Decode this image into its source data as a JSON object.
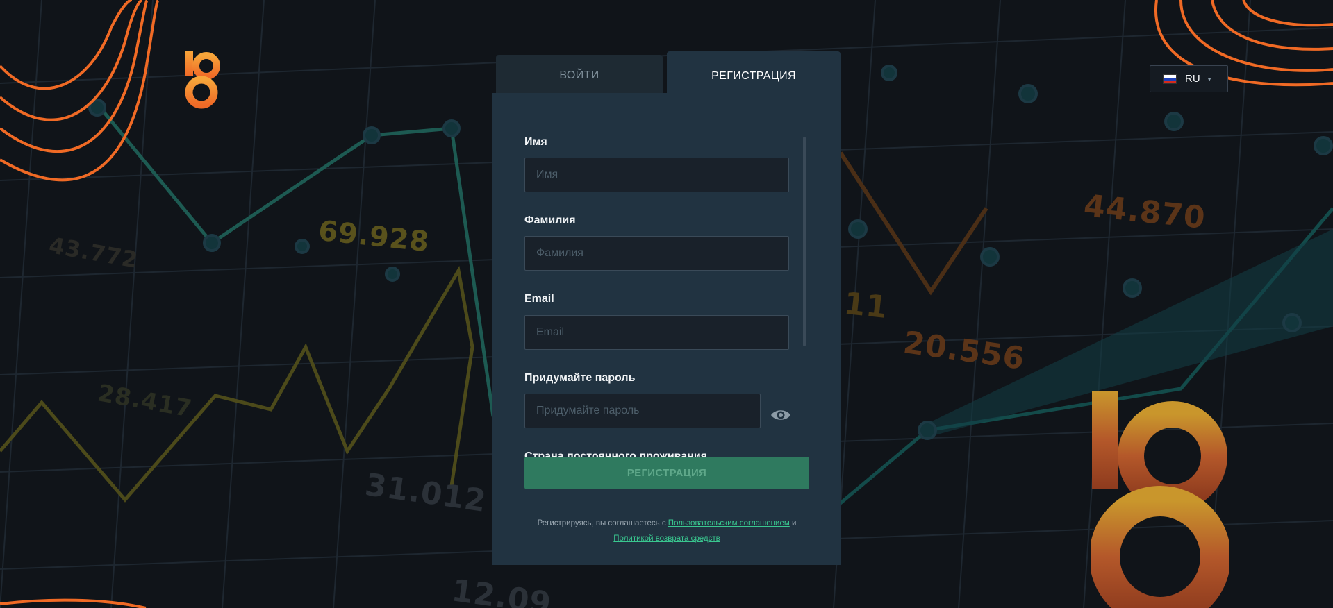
{
  "header": {
    "language": {
      "code": "RU",
      "flag": "russia-flag",
      "flag_colors": [
        "#ffffff",
        "#1c3fb7",
        "#d52b1e"
      ]
    }
  },
  "tabs": [
    {
      "label": "ВОЙТИ",
      "active": false
    },
    {
      "label": "РЕГИСТРАЦИЯ",
      "active": true
    }
  ],
  "form": {
    "first_name": {
      "label": "Имя",
      "placeholder": "Имя",
      "value": ""
    },
    "last_name": {
      "label": "Фамилия",
      "placeholder": "Фамилия",
      "value": ""
    },
    "email": {
      "label": "Email",
      "placeholder": "Email",
      "value": ""
    },
    "password": {
      "label": "Придумайте пароль",
      "placeholder": "Придумайте пароль",
      "value": "",
      "toggle_icon": "eye-icon"
    },
    "country": {
      "label": "Страна постоянного проживания"
    },
    "submit_label": "РЕГИСТРАЦИЯ",
    "terms": {
      "prefix": "Регистрируясь, вы соглашаетесь с",
      "user_agreement": "Пользовательским соглашением",
      "conjunction": "и",
      "refund_policy": "Политикой возврата средств"
    }
  },
  "background": {
    "numbers": [
      "69.928",
      "44.870",
      "20.556",
      "31.012",
      "28.417",
      "43.772",
      "12.09",
      "11"
    ]
  },
  "colors": {
    "page_bg": "#101419",
    "panel_bg": "#213341",
    "accent_green": "#2f7a5f",
    "link_green": "#39c78f",
    "brand_orange": "#f07a2a"
  }
}
